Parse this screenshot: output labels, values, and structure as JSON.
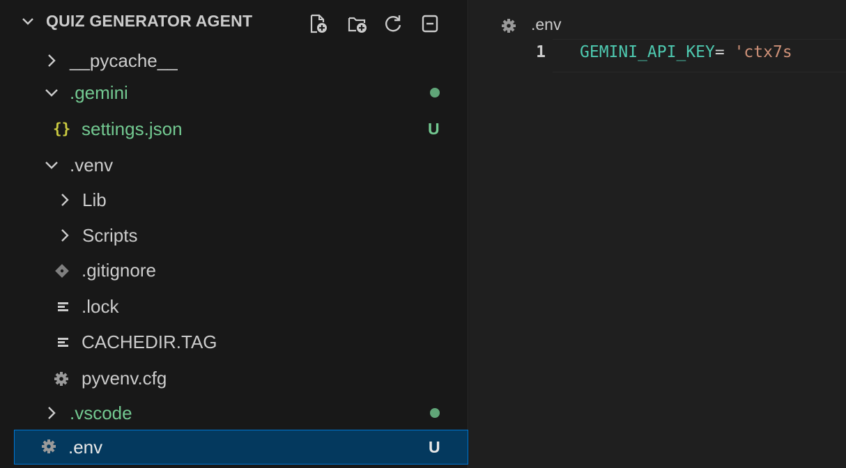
{
  "explorer": {
    "title": "QUIZ GENERATOR AGENT",
    "toolbar": [
      "new-file-icon",
      "new-folder-icon",
      "refresh-icon",
      "collapse-all-icon"
    ],
    "items": [
      {
        "label": "__pycache__",
        "type": "folder",
        "state": "collapsed",
        "badge": ""
      },
      {
        "label": ".gemini",
        "type": "folder",
        "state": "expanded",
        "badge": "modified-dot"
      },
      {
        "label": "settings.json",
        "type": "json-file",
        "badge": "U"
      },
      {
        "label": ".venv",
        "type": "folder",
        "state": "expanded",
        "badge": ""
      },
      {
        "label": "Lib",
        "type": "folder",
        "state": "collapsed",
        "badge": ""
      },
      {
        "label": "Scripts",
        "type": "folder",
        "state": "collapsed",
        "badge": ""
      },
      {
        "label": ".gitignore",
        "type": "git-file",
        "badge": ""
      },
      {
        "label": ".lock",
        "type": "text-file",
        "badge": ""
      },
      {
        "label": "CACHEDIR.TAG",
        "type": "text-file",
        "badge": ""
      },
      {
        "label": "pyvenv.cfg",
        "type": "config-file",
        "badge": ""
      },
      {
        "label": ".vscode",
        "type": "folder",
        "state": "collapsed",
        "badge": "modified-dot"
      },
      {
        "label": ".env",
        "type": "config-file",
        "badge": "U",
        "selected": true
      }
    ]
  },
  "editor": {
    "tab_label": ".env",
    "lines": [
      {
        "number": "1",
        "key": "GEMINI_API_KEY",
        "op": "= ",
        "value": "'ctx7s"
      }
    ]
  },
  "colors": {
    "untracked": "#73c991",
    "selection": "#04395e",
    "selection_border": "#0078d4",
    "background": "#181818"
  }
}
